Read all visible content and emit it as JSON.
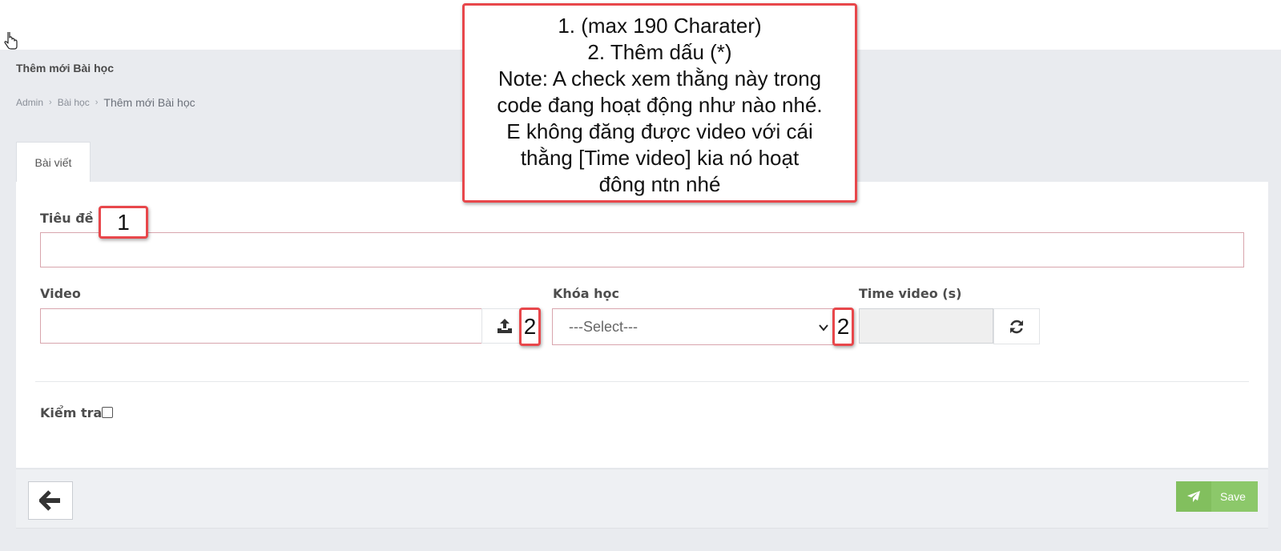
{
  "page": {
    "title": "Thêm mới Bài học",
    "breadcrumb": [
      "Admin",
      "Bài học",
      "Thêm mới Bài học"
    ]
  },
  "tabs": [
    {
      "label": "Bài viết",
      "active": true
    }
  ],
  "form": {
    "title_label": "Tiêu đề",
    "title_value": "",
    "video_label": "Video",
    "video_value": "",
    "course_label": "Khóa học",
    "course_selected": "---Select---",
    "time_label": "Time video (s)",
    "time_value": "",
    "check_label": "Kiểm tra",
    "check_checked": false
  },
  "footer": {
    "back_icon": "arrow-left-icon",
    "save_label": "Save",
    "save_icon": "paper-plane-icon",
    "save_color": "#8cc86a"
  },
  "annotation": {
    "lines": [
      "1. (max 190 Charater)",
      "2. Thêm dấu (*)",
      "Note: A check xem thằng này trong",
      "code đang hoạt động như nào nhé.",
      "E không đăng được video với cái",
      "thằng [Time video] kia nó hoạt",
      "đông ntn nhé"
    ],
    "marker_title": "1",
    "marker_video": "2",
    "marker_course": "2",
    "border_color": "#e8474b"
  }
}
